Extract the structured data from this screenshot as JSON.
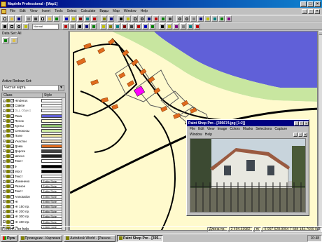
{
  "title": "MapInfo Professional - [Map1]",
  "menu": [
    "File",
    "Edit",
    "View",
    "Insert",
    "Tools",
    "Select",
    "Calculate",
    "Виды",
    "Map",
    "Window",
    "Help"
  ],
  "toolbar": {
    "combo1": "Normal"
  },
  "left_panel": {
    "dataset_label": "Data Set: All",
    "active_label": "Active Redraw Set:",
    "active_value": "Чистая карта",
    "col_class": "Class",
    "col_style": "Style",
    "layers": [
      {
        "name": "Hinderus",
        "checked": true,
        "dim": false,
        "style": ""
      },
      {
        "name": "Ctakke",
        "checked": true,
        "dim": false,
        "style": ""
      },
      {
        "name": "DLL Object",
        "checked": false,
        "dim": true,
        "style": ""
      },
      {
        "name": "Река",
        "checked": true,
        "dim": false,
        "style": ""
      },
      {
        "name": "Песок",
        "checked": true,
        "dim": false,
        "style": ""
      },
      {
        "name": "Кусты",
        "checked": true,
        "dim": false,
        "style": ""
      },
      {
        "name": "Сенокосы",
        "checked": true,
        "dim": false,
        "style": ""
      },
      {
        "name": "Поле",
        "checked": true,
        "dim": false,
        "style": ""
      },
      {
        "name": "Участки",
        "checked": true,
        "dim": false,
        "style": ""
      },
      {
        "name": "Дома",
        "checked": true,
        "dim": false,
        "style": ""
      },
      {
        "name": "Дороги",
        "checked": true,
        "dim": false,
        "style": ""
      },
      {
        "name": "Шоссе",
        "checked": true,
        "dim": false,
        "style": ""
      },
      {
        "name": "Текст",
        "checked": true,
        "dim": false,
        "style": ""
      },
      {
        "name": "9",
        "checked": true,
        "dim": false,
        "style": ""
      },
      {
        "name": "Мост",
        "checked": true,
        "dim": false,
        "style": ""
      },
      {
        "name": "Текст",
        "checked": false,
        "dim": false,
        "style": ""
      },
      {
        "name": "Изменено",
        "checked": false,
        "dim": false,
        "style": "Entity Style"
      },
      {
        "name": "Разное",
        "checked": false,
        "dim": false,
        "style": "Entity Style"
      },
      {
        "name": "Текст",
        "checked": false,
        "dim": false,
        "style": "Entity Style"
      },
      {
        "name": "Annotation",
        "checked": false,
        "dim": false,
        "style": "Entity Style"
      },
      {
        "name": "Hr",
        "checked": false,
        "dim": false,
        "style": "Entity Style"
      },
      {
        "name": "Hr 150 пр.",
        "checked": false,
        "dim": false,
        "style": "Entity Style"
      },
      {
        "name": "Hr 200 пр.",
        "checked": false,
        "dim": false,
        "style": "Entity Style"
      },
      {
        "name": "Hr 300 пр.",
        "checked": false,
        "dim": false,
        "style": "Entity Style"
      },
      {
        "name": "Hr 400 пр.",
        "checked": false,
        "dim": false,
        "style": "Entity Style"
      },
      {
        "name": "Hr",
        "checked": false,
        "dim": false,
        "style": "Entity Style"
      },
      {
        "name": "0HDRW08",
        "checked": false,
        "dim": false,
        "style": "Entity Style"
      }
    ]
  },
  "paint_shop": {
    "title": "Paint Shop Pro - [395674.jpg [1:2]]",
    "menu1": [
      "File",
      "Edit",
      "View",
      "Image",
      "Colors",
      "Masks",
      "Selections",
      "Capture"
    ],
    "menu2": [
      "Window",
      "Help"
    ]
  },
  "status": {
    "message": "Press F1 for help",
    "cell1": "Длина пр.",
    "cell2": "2 494.33982",
    "cell3": "m",
    "cell4": "5 997 628.9064 7 584 182.7699 0.0"
  },
  "taskbar": {
    "start": "Пуск",
    "tasks": [
      "Проводник - Картинки",
      "Autodesk World - [Разное...",
      "Paint Shop Pro - [395..."
    ],
    "active_index": 2,
    "clock": "10:48"
  },
  "colors": {
    "river": "#6060d8",
    "sand": "#fffacd",
    "field": "#c8e6a0",
    "house": "#e06b1e",
    "selected": "#ff00ff"
  }
}
